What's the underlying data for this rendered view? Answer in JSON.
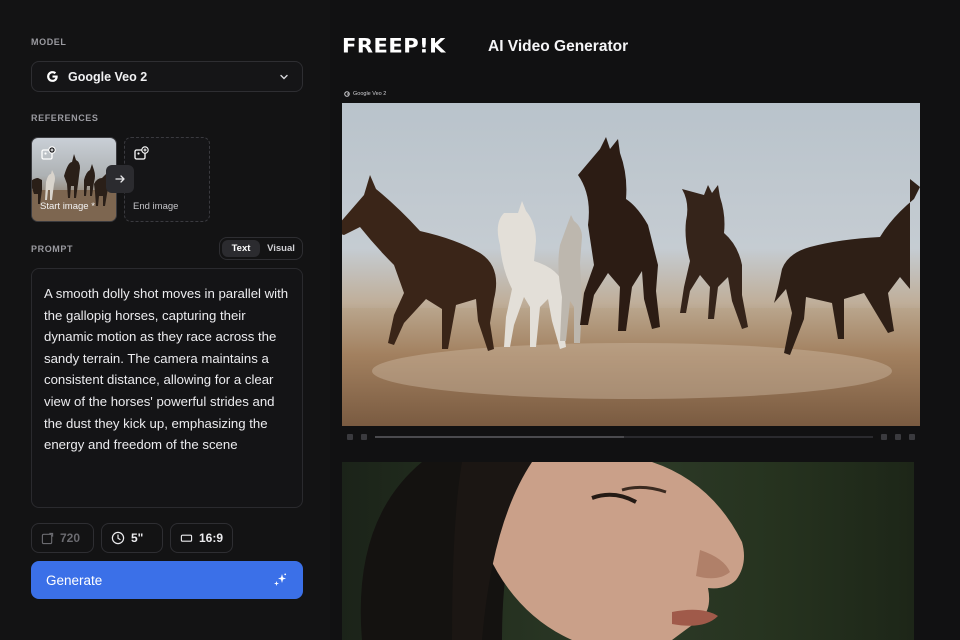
{
  "sidebar": {
    "model_label": "MODEL",
    "model_name": "Google Veo 2",
    "references_label": "REFERENCES",
    "start_image_label": "Start image *",
    "end_image_label": "End image",
    "prompt_label": "PROMPT",
    "mode_tabs": [
      "Text",
      "Visual"
    ],
    "active_mode": "Text",
    "prompt_text": "A smooth dolly shot moves in parallel with the gallopig horses, capturing their dynamic motion as they race across the sandy terrain. The camera maintains a consistent distance, allowing for a clear view of the horses' powerful strides and the dust they kick up, emphasizing the energy and freedom of the scene",
    "resolution": "720",
    "duration": "5\"",
    "aspect_ratio": "16:9",
    "generate_label": "Generate"
  },
  "header": {
    "logo": "FREEP!K",
    "title": "AI Video Generator"
  },
  "gallery": {
    "video_tag": "Google Veo 2",
    "progress_fraction": 0.5
  },
  "colors": {
    "accent": "#3b70e8",
    "background": "#111112"
  }
}
